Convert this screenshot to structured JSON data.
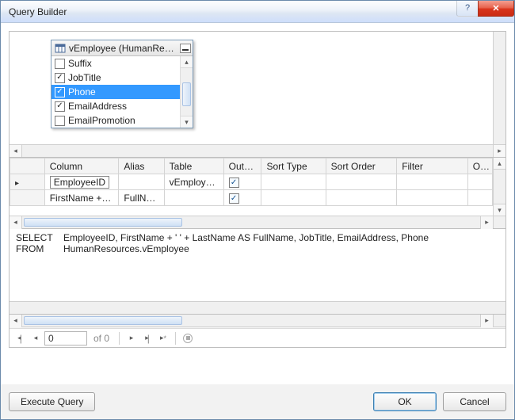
{
  "window": {
    "title": "Query Builder",
    "help_symbol": "?",
    "close_symbol": "✕"
  },
  "diagram": {
    "table_header": "vEmployee (HumanResou...",
    "columns": [
      {
        "name": "Suffix",
        "checked": false,
        "selected": false
      },
      {
        "name": "JobTitle",
        "checked": true,
        "selected": false
      },
      {
        "name": "Phone",
        "checked": true,
        "selected": true
      },
      {
        "name": "EmailAddress",
        "checked": true,
        "selected": false
      },
      {
        "name": "EmailPromotion",
        "checked": false,
        "selected": false
      }
    ]
  },
  "grid": {
    "headers": {
      "column": "Column",
      "alias": "Alias",
      "table": "Table",
      "output": "Outp...",
      "sort_type": "Sort Type",
      "sort_order": "Sort Order",
      "filter": "Filter",
      "or": "Or..."
    },
    "rows": [
      {
        "pointer": true,
        "column": "EmployeeID",
        "alias": "",
        "table": "vEmploye...",
        "output": true
      },
      {
        "pointer": false,
        "column": "FirstName + ' ...",
        "alias": "FullNa...",
        "table": "",
        "output": true
      }
    ]
  },
  "sql": {
    "select_kw": "SELECT",
    "select_body": "EmployeeID, FirstName + ' ' + LastName AS FullName, JobTitle, EmailAddress, Phone",
    "from_kw": "FROM",
    "from_body": "HumanResources.vEmployee"
  },
  "results_nav": {
    "position": "0",
    "of_label": "of 0"
  },
  "footer": {
    "execute": "Execute Query",
    "ok": "OK",
    "cancel": "Cancel"
  },
  "glyph": {
    "tri_left": "◂",
    "tri_right": "▸",
    "tri_up": "▴",
    "tri_down": "▾",
    "bar": "▮",
    "circle": "◯"
  }
}
